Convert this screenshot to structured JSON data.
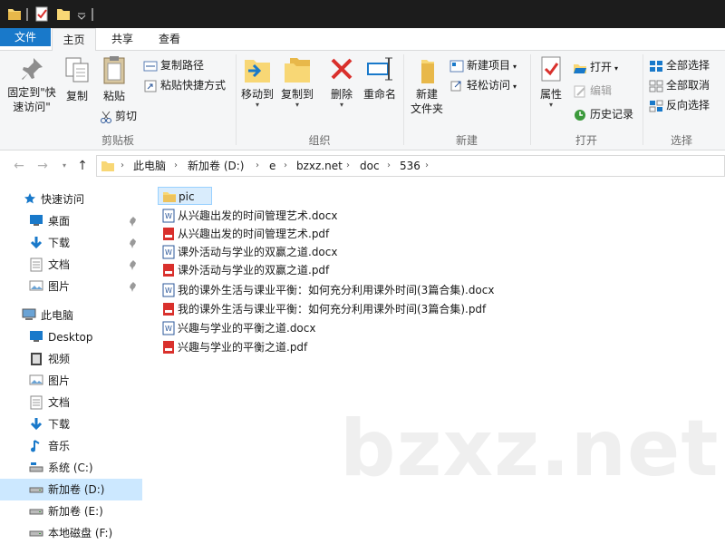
{
  "tabs": {
    "file": "文件",
    "home": "主页",
    "share": "共享",
    "view": "查看"
  },
  "ribbon": {
    "clipboard": {
      "label": "剪贴板",
      "pin_quick": "固定到\"快速访问\"",
      "copy": "复制",
      "paste": "粘贴",
      "copy_path": "复制路径",
      "paste_shortcut": "粘贴快捷方式",
      "cut": "剪切"
    },
    "organize": {
      "label": "组织",
      "move_to": "移动到",
      "copy_to": "复制到",
      "delete": "删除",
      "rename": "重命名"
    },
    "new": {
      "label": "新建",
      "new_folder": "新建\n文件夹",
      "new_item": "新建项目",
      "easy_access": "轻松访问"
    },
    "open": {
      "label": "打开",
      "properties": "属性",
      "open": "打开",
      "edit": "编辑",
      "history": "历史记录"
    },
    "select": {
      "label": "选择",
      "select_all": "全部选择",
      "select_none": "全部取消",
      "invert": "反向选择"
    }
  },
  "address": {
    "crumbs": [
      "此电脑",
      "新加卷 (D:)",
      "e",
      "bzxz.net",
      "doc",
      "536"
    ]
  },
  "nav": {
    "quick_access": "快速访问",
    "quick_items": [
      "桌面",
      "下载",
      "文档",
      "图片"
    ],
    "this_pc": "此电脑",
    "pc_items": [
      "Desktop",
      "视频",
      "图片",
      "文档",
      "下载",
      "音乐",
      "系统 (C:)",
      "新加卷 (D:)",
      "新加卷 (E:)",
      "本地磁盘 (F:)"
    ]
  },
  "files": [
    {
      "name": "pic",
      "type": "folder"
    },
    {
      "name": "从兴趣出发的时间管理艺术.docx",
      "type": "docx"
    },
    {
      "name": "从兴趣出发的时间管理艺术.pdf",
      "type": "pdf"
    },
    {
      "name": "课外活动与学业的双赢之道.docx",
      "type": "docx"
    },
    {
      "name": "课外活动与学业的双赢之道.pdf",
      "type": "pdf"
    },
    {
      "name": "我的课外生活与课业平衡：如何充分利用课外时间(3篇合集).docx",
      "type": "docx"
    },
    {
      "name": "我的课外生活与课业平衡：如何充分利用课外时间(3篇合集).pdf",
      "type": "pdf"
    },
    {
      "name": "兴趣与学业的平衡之道.docx",
      "type": "docx"
    },
    {
      "name": "兴趣与学业的平衡之道.pdf",
      "type": "pdf"
    }
  ],
  "watermark": "bzxz.net",
  "colors": {
    "accent": "#1979ca",
    "folder": "#f8d775",
    "pdf": "#d9302c",
    "word": "#2b579a",
    "selected": "#cce8ff"
  }
}
